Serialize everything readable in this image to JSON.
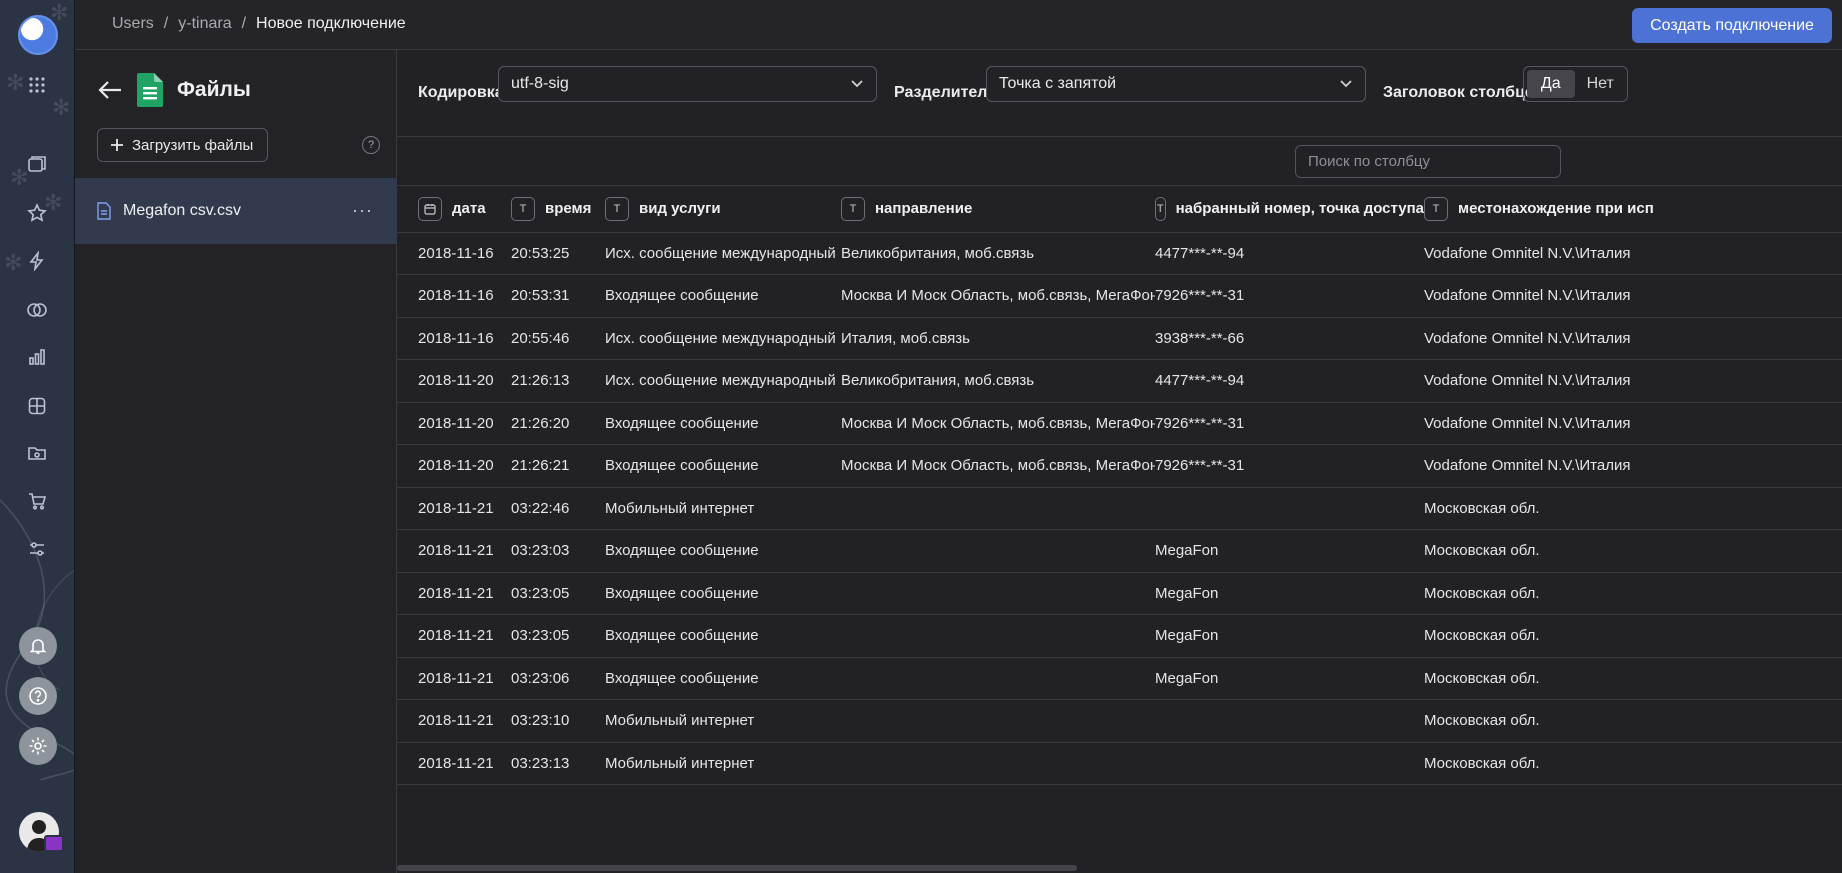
{
  "breadcrumb": {
    "items": [
      "Users",
      "y-tinara"
    ],
    "separator": "/",
    "current": "Новое подключение"
  },
  "create_button": "Создать подключение",
  "files_panel": {
    "title": "Файлы",
    "upload_label": "Загрузить файлы",
    "help": "?",
    "file_name": "Megafon csv.csv",
    "more": "···"
  },
  "settings": {
    "encoding_label": "Кодировка",
    "encoding_value": "utf-8-sig",
    "delimiter_label": "Разделитель",
    "delimiter_value": "Точка с запятой",
    "header_label": "Заголовок столбцов",
    "header_yes": "Да",
    "header_no": "Нет"
  },
  "column_search": {
    "placeholder": "Поиск по столбцу"
  },
  "table": {
    "columns": [
      {
        "label": "дата",
        "type": "date"
      },
      {
        "label": "время",
        "type": "T"
      },
      {
        "label": "вид услуги",
        "type": "T"
      },
      {
        "label": "направление",
        "type": "T"
      },
      {
        "label": "набранный номер, точка доступа",
        "type": "T"
      },
      {
        "label": "местонахождение при исп",
        "type": "T"
      }
    ],
    "rows": [
      [
        "2018-11-16",
        "20:53:25",
        "Исх. сообщение международный",
        "Великобритания, моб.связь",
        "4477***-**-94",
        "Vodafone Omnitel N.V.\\Италия"
      ],
      [
        "2018-11-16",
        "20:53:31",
        "Входящее сообщение",
        "Москва И Моск Область, моб.связь, МегаФон",
        "7926***-**-31",
        "Vodafone Omnitel N.V.\\Италия"
      ],
      [
        "2018-11-16",
        "20:55:46",
        "Исх. сообщение международный",
        "Италия, моб.связь",
        "3938***-**-66",
        "Vodafone Omnitel N.V.\\Италия"
      ],
      [
        "2018-11-20",
        "21:26:13",
        "Исх. сообщение международный",
        "Великобритания, моб.связь",
        "4477***-**-94",
        "Vodafone Omnitel N.V.\\Италия"
      ],
      [
        "2018-11-20",
        "21:26:20",
        "Входящее сообщение",
        "Москва И Моск Область, моб.связь, МегаФон",
        "7926***-**-31",
        "Vodafone Omnitel N.V.\\Италия"
      ],
      [
        "2018-11-20",
        "21:26:21",
        "Входящее сообщение",
        "Москва И Моск Область, моб.связь, МегаФон",
        "7926***-**-31",
        "Vodafone Omnitel N.V.\\Италия"
      ],
      [
        "2018-11-21",
        "03:22:46",
        "Мобильный интернет",
        "",
        "",
        "Московская обл."
      ],
      [
        "2018-11-21",
        "03:23:03",
        "Входящее сообщение",
        "",
        "MegaFon",
        "Московская обл."
      ],
      [
        "2018-11-21",
        "03:23:05",
        "Входящее сообщение",
        "",
        "MegaFon",
        "Московская обл."
      ],
      [
        "2018-11-21",
        "03:23:05",
        "Входящее сообщение",
        "",
        "MegaFon",
        "Московская обл."
      ],
      [
        "2018-11-21",
        "03:23:06",
        "Входящее сообщение",
        "",
        "MegaFon",
        "Московская обл."
      ],
      [
        "2018-11-21",
        "03:23:10",
        "Мобильный интернет",
        "",
        "",
        "Московская обл."
      ],
      [
        "2018-11-21",
        "03:23:13",
        "Мобильный интернет",
        "",
        "",
        "Московская обл."
      ]
    ]
  },
  "sidebar_icons": [
    "logo",
    "apps-grid-icon",
    "collections-icon",
    "star-icon",
    "bolt-icon",
    "connections-icon",
    "chart-icon",
    "dashboard-icon",
    "folder-icon",
    "cart-icon",
    "settings-sliders-icon",
    "bell-icon",
    "help-icon",
    "gear-icon",
    "avatar"
  ],
  "colors": {
    "accent": "#4b72d4",
    "rail": "#2a3445",
    "selected_row": "#323a4e",
    "background": "#222125"
  }
}
